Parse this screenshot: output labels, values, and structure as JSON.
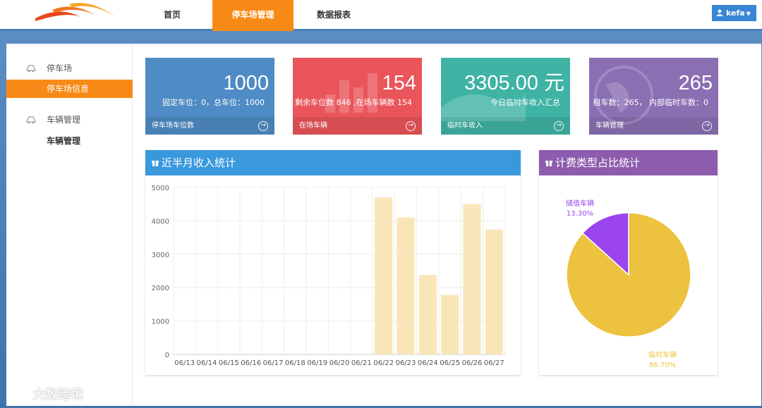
{
  "nav": {
    "items": [
      {
        "label": "首页",
        "active": false
      },
      {
        "label": "停车场管理",
        "active": true
      },
      {
        "label": "数据报表",
        "active": false
      }
    ],
    "user": {
      "name": "kefa"
    }
  },
  "sidebar": {
    "groups": [
      {
        "label": "停车场",
        "items": [
          {
            "label": "停车场信息",
            "active": true
          }
        ]
      },
      {
        "label": "车辆管理",
        "items": [
          {
            "label": "车辆管理",
            "active": false
          }
        ]
      }
    ]
  },
  "cards": [
    {
      "value": "1000",
      "desc": "固定车位：0，总车位：1000",
      "footer": "停车场车位数",
      "color": "#4f8bc4"
    },
    {
      "value": "154",
      "desc": "剩余车位数 846 ,在场车辆数 154",
      "footer": "在场车辆",
      "color": "#e9555a"
    },
    {
      "value": "3305.00 元",
      "desc": "今日临时车收入汇总",
      "footer": "临时车收入",
      "color": "#3fb3a4"
    },
    {
      "value": "265",
      "desc": "租车数：265， 内部临时车数：0",
      "footer": "车辆管理",
      "color": "#8a6fb2"
    }
  ],
  "income_panel": {
    "title": "近半月收入统计",
    "color": "#3a98dd"
  },
  "pie_panel": {
    "title": "计费类型占比统计",
    "color": "#8e5cae"
  },
  "chart_data": [
    {
      "type": "bar",
      "title": "近半月收入统计",
      "categories": [
        "06/13",
        "06/14",
        "06/15",
        "06/16",
        "06/17",
        "06/18",
        "06/19",
        "06/20",
        "06/21",
        "06/22",
        "06/23",
        "06/24",
        "06/25",
        "06/26",
        "06/27"
      ],
      "values": [
        0,
        0,
        0,
        0,
        0,
        0,
        0,
        0,
        0,
        4700,
        4100,
        2380,
        1780,
        4500,
        3740
      ],
      "ylim": [
        0,
        5000
      ],
      "yticks": [
        0,
        1000,
        2000,
        3000,
        4000,
        5000
      ],
      "grid": true,
      "bar_color": "#f9e6b8"
    },
    {
      "type": "pie",
      "title": "计费类型占比统计",
      "slices": [
        {
          "label": "储值车辆",
          "percent": "13.30%",
          "value": 13.3,
          "color": "#9b45ee"
        },
        {
          "label": "临时车辆",
          "percent": "86.70%",
          "value": 86.7,
          "color": "#ecc23f"
        }
      ]
    }
  ],
  "watermark": "大数跨境"
}
